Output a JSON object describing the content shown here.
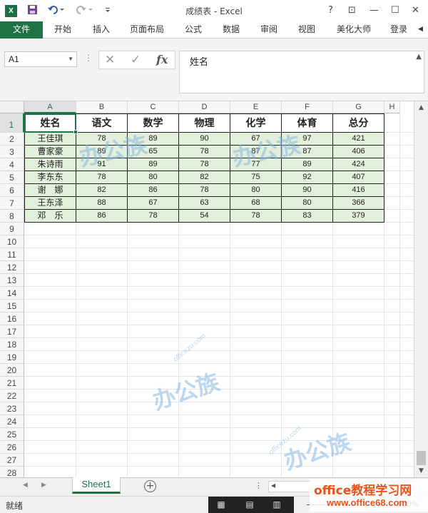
{
  "titlebar": {
    "app_icon": "X",
    "title": "成绩表 - Excel",
    "help": "?",
    "ribbon_display": "⊡",
    "minimize": "—",
    "maximize": "☐",
    "close": "✕",
    "save_icon": "save-icon",
    "undo_icon": "undo-icon",
    "redo_icon": "redo-icon"
  },
  "ribbon": {
    "tabs": [
      "文件",
      "开始",
      "插入",
      "页面布局",
      "公式",
      "数据",
      "审阅",
      "视图",
      "美化大师"
    ],
    "login": "登录"
  },
  "formula_bar": {
    "name_box": "A1",
    "cancel": "✕",
    "enter": "✓",
    "fx": "fx",
    "content": "姓名"
  },
  "sheet": {
    "columns": [
      "A",
      "B",
      "C",
      "D",
      "E",
      "F",
      "G",
      "H"
    ],
    "rows": [
      "1",
      "2",
      "3",
      "4",
      "5",
      "6",
      "7",
      "8",
      "9",
      "10",
      "11",
      "12",
      "13",
      "14",
      "15",
      "16",
      "17",
      "18",
      "19",
      "20",
      "21",
      "22",
      "23",
      "24",
      "25",
      "26",
      "27",
      "28"
    ],
    "headers": [
      "姓名",
      "语文",
      "数学",
      "物理",
      "化学",
      "体育",
      "总分"
    ],
    "data": [
      [
        "王佳琪",
        "78",
        "89",
        "90",
        "67",
        "97",
        "421"
      ],
      [
        "曹家豪",
        "89",
        "65",
        "78",
        "87",
        "87",
        "406"
      ],
      [
        "朱诗雨",
        "91",
        "89",
        "78",
        "77",
        "89",
        "424"
      ],
      [
        "李东东",
        "78",
        "80",
        "82",
        "75",
        "92",
        "407"
      ],
      [
        "谢　娜",
        "82",
        "86",
        "78",
        "80",
        "90",
        "416"
      ],
      [
        "王东泽",
        "88",
        "67",
        "63",
        "68",
        "80",
        "366"
      ],
      [
        "邓　乐",
        "86",
        "78",
        "54",
        "78",
        "83",
        "379"
      ]
    ],
    "active_cell": "A1"
  },
  "sheet_tabs": {
    "tabs": [
      "Sheet1"
    ],
    "add": "+"
  },
  "statusbar": {
    "status": "就绪",
    "zoom": "100%"
  },
  "watermark": {
    "main": "办公族",
    "sub": "officezu.com",
    "site_1": "office教程学习网",
    "site_2": "www.office68.com"
  },
  "colors": {
    "accent": "#217346",
    "band": "#e2efda"
  }
}
